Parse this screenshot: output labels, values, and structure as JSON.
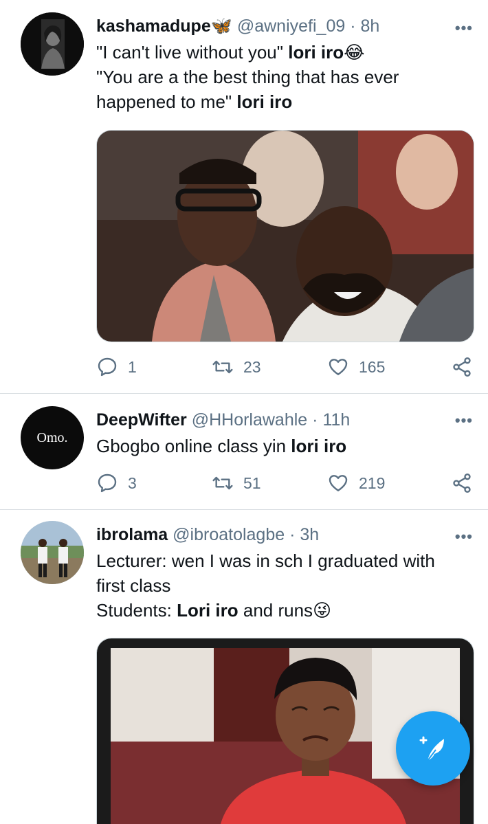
{
  "tweets": [
    {
      "name": "kashamadupe",
      "name_emoji": "🦋",
      "handle": "@awniyefi_09",
      "time": "8h",
      "lines": [
        {
          "plain": "\"I can't live without you\" ",
          "bold": "lori iro",
          "emoji": "😂"
        },
        {
          "plain": "\"You are a the best thing that has ever",
          "bold": "",
          "emoji": ""
        },
        {
          "plain": "happened to me\" ",
          "bold": "lori iro",
          "emoji": ""
        }
      ],
      "replies": "1",
      "retweets": "23",
      "likes": "165"
    },
    {
      "name": "DeepWifter",
      "handle": "@HHorlawahle",
      "time": "11h",
      "avatar_text": "Omo.",
      "lines": [
        {
          "plain": "Gbogbo online class yin ",
          "bold": "lori iro",
          "emoji": ""
        }
      ],
      "replies": "3",
      "retweets": "51",
      "likes": "219"
    },
    {
      "name": "ibrolama",
      "handle": "@ibroatolagbe",
      "time": "3h",
      "lines": [
        {
          "plain": "Lecturer: wen I was in sch I graduated with",
          "bold": "",
          "emoji": ""
        },
        {
          "plain": "first class",
          "bold": "",
          "emoji": ""
        },
        {
          "plain": "Students: ",
          "bold": "Lori iro",
          "after": " and runs",
          "emoji": "😜"
        }
      ]
    }
  ],
  "sep": "·",
  "icons": {
    "reply": "reply-icon",
    "retweet": "retweet-icon",
    "like": "heart-icon",
    "share": "share-icon",
    "more": "more-icon",
    "compose": "compose-tweet-icon"
  },
  "colors": {
    "accent": "#1da1f2",
    "secondary_text": "#5b7083",
    "divider": "#d9dee2"
  }
}
